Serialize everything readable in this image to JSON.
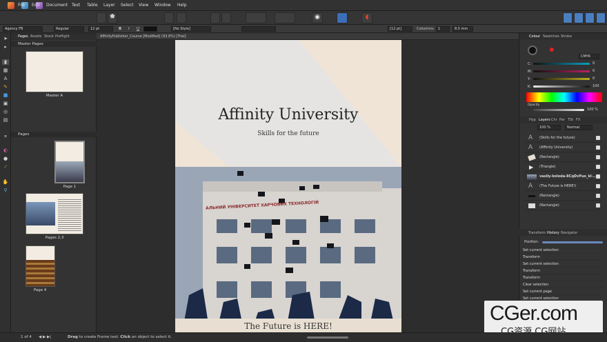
{
  "menu": [
    "File",
    "Edit",
    "Document",
    "Text",
    "Table",
    "Layer",
    "Select",
    "View",
    "Window",
    "Help"
  ],
  "context": {
    "font": "Agency FB",
    "weight": "Regular",
    "size": "12 pt",
    "style": "[No Style]",
    "columns_label": "Columns:",
    "columns": "1",
    "gutter": "8.5 mm",
    "leading": "[12 pt]",
    "bold": "B",
    "italic": "I",
    "underline": "U"
  },
  "left_panel": {
    "tabs": [
      "Pages",
      "Assets",
      "Stock",
      "Preflight"
    ],
    "master_header": "Master Pages",
    "master_label": "Master A",
    "pages_header": "Pages",
    "page_labels": [
      "Page 1",
      "Pages 2,3",
      "Page 4"
    ]
  },
  "doc_tab": "AffinityPublisher_Course [Modified] (93.6%) [Trial]",
  "page": {
    "title": "Affinity University",
    "subtitle": "Skills for the future",
    "bottom_text": "The Future is HERE!",
    "building_sign": "АЛЬНИЙ УНІВЕРСИТЕТ ХАРЧОВИХ ТЕХНОЛОГІЙ"
  },
  "right_panel": {
    "color_tabs": [
      "Colour",
      "Swatches",
      "Stroke"
    ],
    "color_model": "CMYK",
    "channels": [
      {
        "label": "C:",
        "value": "0"
      },
      {
        "label": "M:",
        "value": "0"
      },
      {
        "label": "Y:",
        "value": "0"
      },
      {
        "label": "K:",
        "value": "100"
      }
    ],
    "opacity_label": "Opacity",
    "opacity_value": "100 %",
    "layer_tabs": [
      "Hyp",
      "Layers",
      "Chr",
      "Par",
      "TSt",
      "FX"
    ],
    "layer_opacity": "100 %",
    "blend": "Normal",
    "layers": [
      "(Skills for the future)",
      "(Affinity University)",
      "(Rectangle)",
      "(Triangle)",
      "vasily-koloda-8CqDvPuo_kI-...",
      "(The Future is HERE!)",
      "(Rectangle)",
      "(Rectangle)"
    ],
    "hist_tabs": [
      "Transform",
      "History",
      "Navigator"
    ],
    "position_label": "Position:",
    "history": [
      "Set current selection",
      "Transform",
      "Set current selection",
      "Transform",
      "Transform",
      "Clear selection",
      "Set current page",
      "Set current selection"
    ]
  },
  "status": {
    "page": "1 of 4",
    "hint_bold1": "Drag",
    "hint1": " to create Frame text. ",
    "hint_bold2": "Click",
    "hint2": " an object to select it."
  },
  "watermark": {
    "main": "CGer.com",
    "sub": "CG资源  CG网站"
  },
  "colors": {
    "accent": "#e04a2a",
    "panel": "#333333"
  }
}
